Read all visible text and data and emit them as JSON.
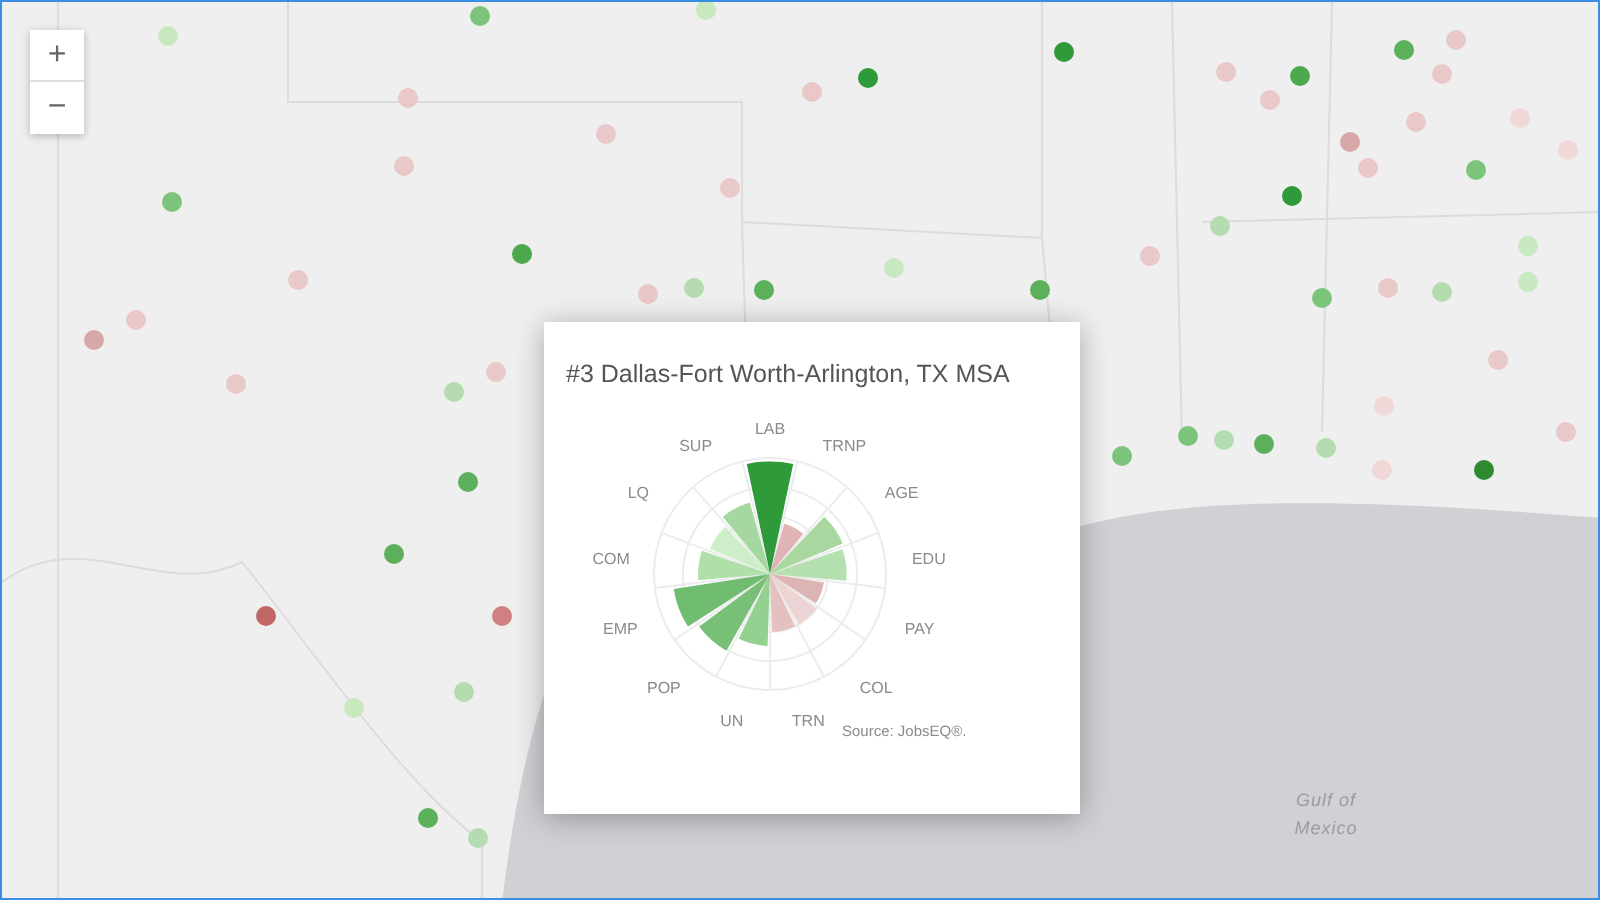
{
  "zoom_controls": [
    {
      "label": "+"
    },
    {
      "label": "−"
    }
  ],
  "map": {
    "water_label": "Gulf of Mexico",
    "markers": [
      {
        "color": "#c8e8c0"
      },
      {
        "color": "#7cc47c"
      },
      {
        "color": "#c8e8c0"
      },
      {
        "color": "#2e9a3a"
      },
      {
        "color": "#2e9a3a"
      },
      {
        "color": "#e8c8c8"
      },
      {
        "color": "#e8c8c8"
      },
      {
        "color": "#e8c8c8"
      },
      {
        "color": "#e8c8c8"
      },
      {
        "color": "#e8c8c8"
      },
      {
        "color": "#7cc47c"
      },
      {
        "color": "#4ca84c"
      },
      {
        "color": "#e8c8c8"
      },
      {
        "color": "#e8c8c8"
      },
      {
        "color": "#b4dcb0"
      },
      {
        "color": "#5cb05c"
      },
      {
        "color": "#c8e8c0"
      },
      {
        "color": "#5cb05c"
      },
      {
        "color": "#e8c8c8"
      },
      {
        "color": "#d8a8a8"
      },
      {
        "color": "#e8c8c8"
      },
      {
        "color": "#e8c8c8"
      },
      {
        "color": "#b4dcb0"
      },
      {
        "color": "#5cb05c"
      },
      {
        "color": "#5cb05c"
      },
      {
        "color": "#c06868"
      },
      {
        "color": "#d08080"
      },
      {
        "color": "#c8e8c0"
      },
      {
        "color": "#b4dcb0"
      },
      {
        "color": "#5cb05c"
      },
      {
        "color": "#b4dcb0"
      },
      {
        "color": "#7cc47c"
      },
      {
        "color": "#7cc47c"
      },
      {
        "color": "#b4dcb0"
      },
      {
        "color": "#5cb05c"
      },
      {
        "color": "#b4dcb0"
      },
      {
        "color": "#f0d8d8"
      },
      {
        "color": "#2e8a2e"
      },
      {
        "color": "#e8c8c8"
      },
      {
        "color": "#e8c8c8"
      },
      {
        "color": "#f0d8d8"
      },
      {
        "color": "#5cb05c"
      },
      {
        "color": "#e8c8c8"
      },
      {
        "color": "#e8c8c8"
      },
      {
        "color": "#e8c8c8"
      },
      {
        "color": "#e8c8c8"
      },
      {
        "color": "#4ca84c"
      },
      {
        "color": "#e8c8c8"
      },
      {
        "color": "#d8a8a8"
      },
      {
        "color": "#e8c8c8"
      },
      {
        "color": "#2e9a3a"
      },
      {
        "color": "#7cc47c"
      },
      {
        "color": "#f0d8d8"
      },
      {
        "color": "#f0d8d8"
      },
      {
        "color": "#b4dcb0"
      },
      {
        "color": "#c8e8c0"
      },
      {
        "color": "#c8e8c0"
      },
      {
        "color": "#7cc47c"
      },
      {
        "color": "#e8c8c8"
      },
      {
        "color": "#b4dcb0"
      },
      {
        "color": "#e8c8c8"
      }
    ]
  },
  "popup": {
    "title": "#3 Dallas-Fort Worth-Arlington, TX MSA",
    "source": "Source: JobsEQ®.",
    "axes": [
      {
        "label": "LAB",
        "color": "#2e9a3a"
      },
      {
        "label": "TRNP",
        "color": "#e0b4b4"
      },
      {
        "label": "AGE",
        "color": "#a8d8a0"
      },
      {
        "label": "EDU",
        "color": "#b4e0b0"
      },
      {
        "label": "PAY",
        "color": "#dcb4b4"
      },
      {
        "label": "COL",
        "color": "#ecd4d4"
      },
      {
        "label": "TRN",
        "color": "#e4c0c0"
      },
      {
        "label": "UN",
        "color": "#94d090"
      },
      {
        "label": "POP",
        "color": "#78c078"
      },
      {
        "label": "EMP",
        "color": "#70bc70"
      },
      {
        "label": "COM",
        "color": "#b0e0aa"
      },
      {
        "label": "LQ",
        "color": "#cdeec8"
      },
      {
        "label": "SUP",
        "color": "#a4d8a0"
      }
    ]
  }
}
